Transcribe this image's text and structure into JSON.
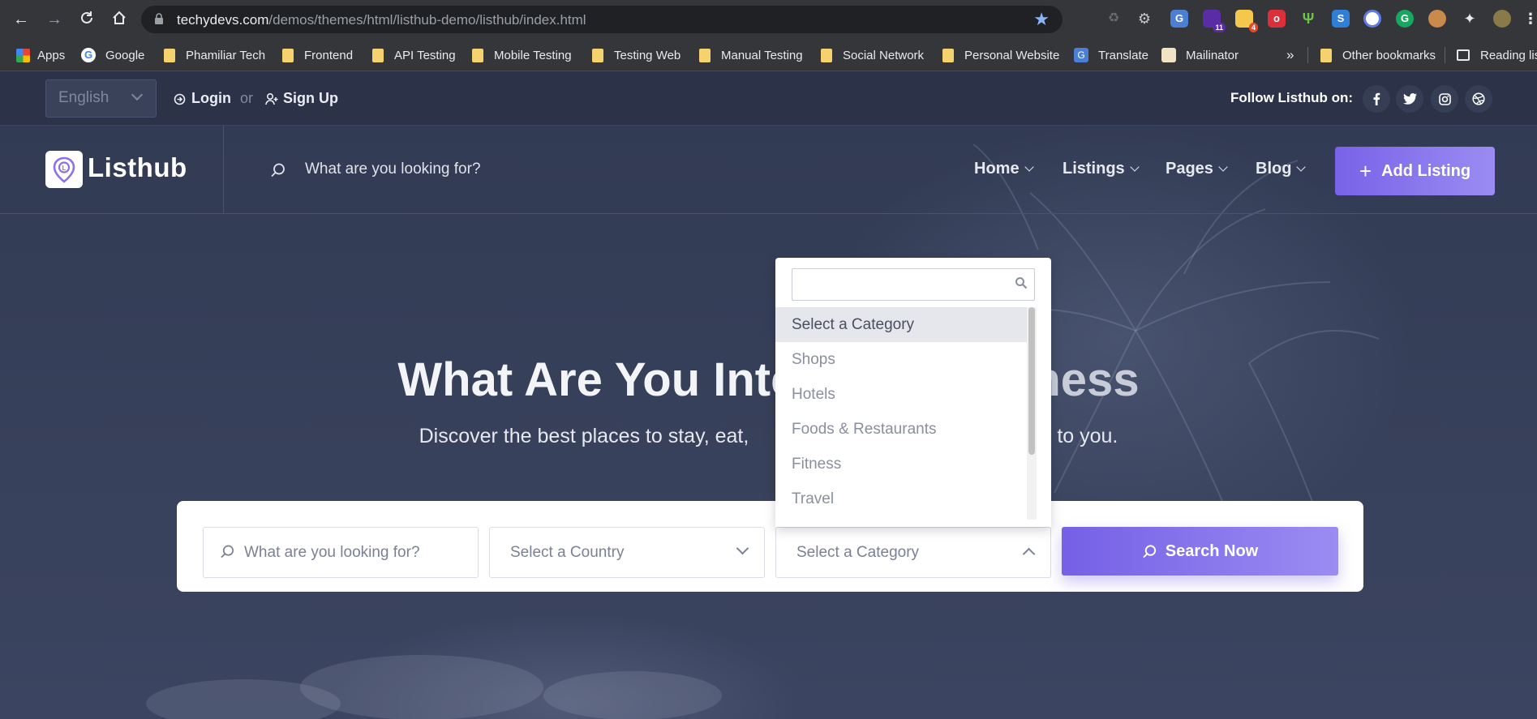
{
  "browser": {
    "url_host": "techydevs.com",
    "url_path": "/demos/themes/html/listhub-demo/listhub/index.html",
    "extension_badges": {
      "ext_11": "11",
      "ext_4": "4"
    },
    "bookmarks": [
      {
        "label": "Apps"
      },
      {
        "label": "Google"
      },
      {
        "label": "Phamiliar Tech"
      },
      {
        "label": "Frontend"
      },
      {
        "label": "API Testing"
      },
      {
        "label": "Mobile Testing"
      },
      {
        "label": "Testing Web"
      },
      {
        "label": "Manual Testing"
      },
      {
        "label": "Social Network"
      },
      {
        "label": "Personal Website"
      },
      {
        "label": "Translate"
      },
      {
        "label": "Mailinator"
      }
    ],
    "overflow": "»",
    "other_bookmarks": "Other bookmarks",
    "reading_list": "Reading list"
  },
  "topbar": {
    "language": "English",
    "login": "Login",
    "or": "or",
    "signup": "Sign Up",
    "follow": "Follow Listhub on:"
  },
  "navbar": {
    "logo": "Listhub",
    "search_placeholder": "What are you looking for?",
    "menu": [
      "Home",
      "Listings",
      "Pages",
      "Blog"
    ],
    "add_listing": "Add Listing"
  },
  "hero": {
    "headline_left": "What Are You Inte",
    "headline_right": "ness",
    "subline_left": "Discover the best places to stay, eat,",
    "subline_right": "to you."
  },
  "search_form": {
    "keyword_placeholder": "What are you looking for?",
    "country": "Select a Country",
    "category": "Select a Category",
    "submit": "Search Now"
  },
  "category_dropdown": {
    "search_value": "",
    "options": [
      "Select a Category",
      "Shops",
      "Hotels",
      "Foods & Restaurants",
      "Fitness",
      "Travel"
    ],
    "selected": "Select a Category"
  },
  "colors": {
    "accent": "#7862e8",
    "topbar_bg": "#2c3348",
    "page_bg": "#343c55"
  }
}
